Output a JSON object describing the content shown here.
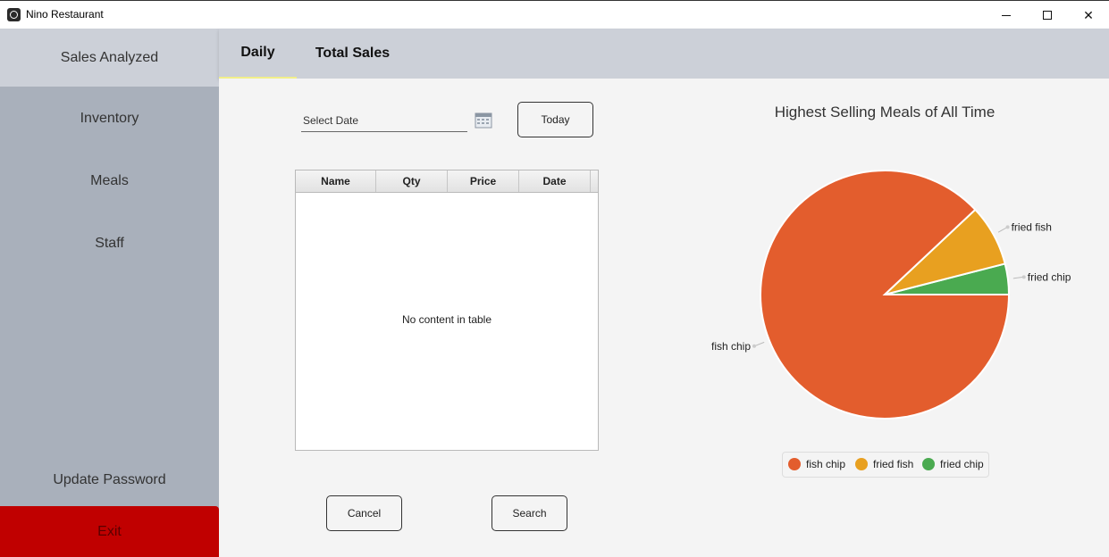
{
  "window": {
    "title": "Nino Restaurant",
    "minimize": "—",
    "maximize": "☐",
    "close": "✕"
  },
  "sidebar": {
    "items": [
      {
        "label": "Sales Analyzed"
      },
      {
        "label": "Inventory"
      },
      {
        "label": "Meals"
      },
      {
        "label": "Staff"
      },
      {
        "label": "Update Password"
      },
      {
        "label": "Exit"
      }
    ]
  },
  "tabs": [
    {
      "label": "Daily"
    },
    {
      "label": "Total Sales"
    }
  ],
  "daily": {
    "date_placeholder": "Select Date",
    "today_label": "Today",
    "table": {
      "columns": [
        "Name",
        "Qty",
        "Price",
        "Date"
      ],
      "rows": [],
      "empty_message": "No content in table"
    },
    "cancel_label": "Cancel",
    "search_label": "Search"
  },
  "chart_data": {
    "type": "pie",
    "title": "Highest Selling Meals of All Time",
    "labels": [
      "fish chip",
      "fried fish",
      "fried chip"
    ],
    "values": [
      88,
      8,
      4
    ],
    "colors": [
      "#e35d2d",
      "#e8a020",
      "#4aaa50"
    ],
    "legend": "bottom",
    "legend_entries": [
      "fish chip",
      "fried fish",
      "fried chip"
    ]
  },
  "colors": {
    "sidebar": "#a9b0bb",
    "sidebar_active": "#ccd0d8",
    "exit": "#c00000",
    "tab_underline": "#f1ef8a"
  }
}
